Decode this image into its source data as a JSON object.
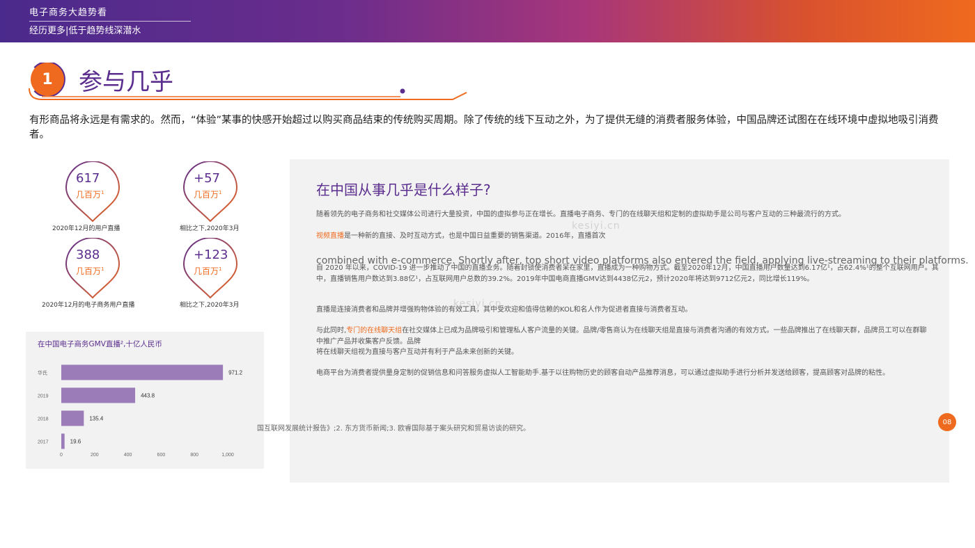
{
  "header": {
    "title": "电子商务大趋势看",
    "subtitle": "经历更多|低于趋势线深潜水"
  },
  "section": {
    "number": "1",
    "title": "参与几乎"
  },
  "intro": "有形商品将永远是有需求的。然而，“体验”某事的快感开始超过以购买商品结束的传统购买周期。除了传统的线下互动之外，为了提供无缝的消费者服务体验，中国品牌还试图在在线环境中虚拟地吸引消费者。",
  "stats": [
    {
      "value": "617",
      "unit": "几百万",
      "sup": "1",
      "caption": "2020年12月的用户直播"
    },
    {
      "value": "+57",
      "unit": "几百万",
      "sup": "1",
      "caption": "相比之下,2020年3月"
    },
    {
      "value": "388",
      "unit": "几百万",
      "sup": "1",
      "caption": "2020年12月的电子商务用户直播"
    },
    {
      "value": "+123",
      "unit": "几百万",
      "sup": "1",
      "caption": "相比之下,2020年3月"
    }
  ],
  "chart_data": {
    "type": "bar",
    "orientation": "horizontal",
    "title": "在中国电子商务GMV直播²,十亿人民币",
    "categories": [
      "华氏",
      "2019",
      "2018",
      "2017"
    ],
    "values": [
      971.2,
      443.8,
      135.4,
      19.6
    ],
    "xticks": [
      "0",
      "200",
      "400",
      "600",
      "800",
      "1,000"
    ],
    "xlim": [
      0,
      1000
    ],
    "color": "#9b7bb8"
  },
  "panel": {
    "title": "在中国从事几乎是什么样子?",
    "p1": "随着领先的电子商务和社交媒体公司进行大量投资，中国的虚拟参与正在增长。直播电子商务、专门的在线聊天组和定制的虚拟助手是公司与客户互动的三种最流行的方式。",
    "p2_hl": "视频直播",
    "p2": "是一种新的直接、及时互动方式，也是中国日益重要的销售渠道。2016年，直播首次",
    "p2_en": "combined with e-commerce. Shortly after, top short video platforms also entered the field, applying live-streaming to their platforms.",
    "p3": "自 2020 年以来，COVID-19 进一步推动了中国的直播业务。随着封锁使消费者呆在家里，直播成为一种购物方式。截至2020年12月，中国直播用户数量达到6.17亿¹，占62.4%¹的整个互联网用户。其中，直播销售用户数达到3.88亿¹，占互联网用户总数的39.2%。2019年中国电商直播GMV达到4438亿元2，预计2020年将达到9712亿元2，同比增长119%。",
    "p4": "直播是连接消费者和品牌并增强购物体验的有效工具，其中受欢迎和值得信赖的KOL和名人作为促进者直接与消费者互动。",
    "p5_pre": "与此同时,",
    "p5_hl": "专门的在线聊天组",
    "p5": "在社交媒体上已成为品牌吸引和管理私人客户流量的关键。品牌/零售商认为在线聊天组是直接与消费者沟通的有效方式。一些品牌推出了在线聊天群，品牌员工可以在群聊中推广产品并收集客户反馈。品牌",
    "p5b": "将在线聊天组视为直接与客户互动并有利于产品未来创新的关键。",
    "p6": "电商平台为消费者提供量身定制的促销信息和问答服务虚拟人工智能助手.基于以往购物历史的顾客自动产品推荐消息，可以通过虚拟助手进行分析并发送给顾客，提高顾客对品牌的粘性。",
    "watermark": "kesiyi.cn"
  },
  "footnote": "国互联网发展统计报告》;2. 东方货币新闻;3. 欧睿国际基于案头研究和贸易访谈的研究。",
  "page_number": "08",
  "colors": {
    "purple": "#5b2d8e",
    "orange": "#ef6a1e",
    "bar": "#9b7bb8"
  }
}
